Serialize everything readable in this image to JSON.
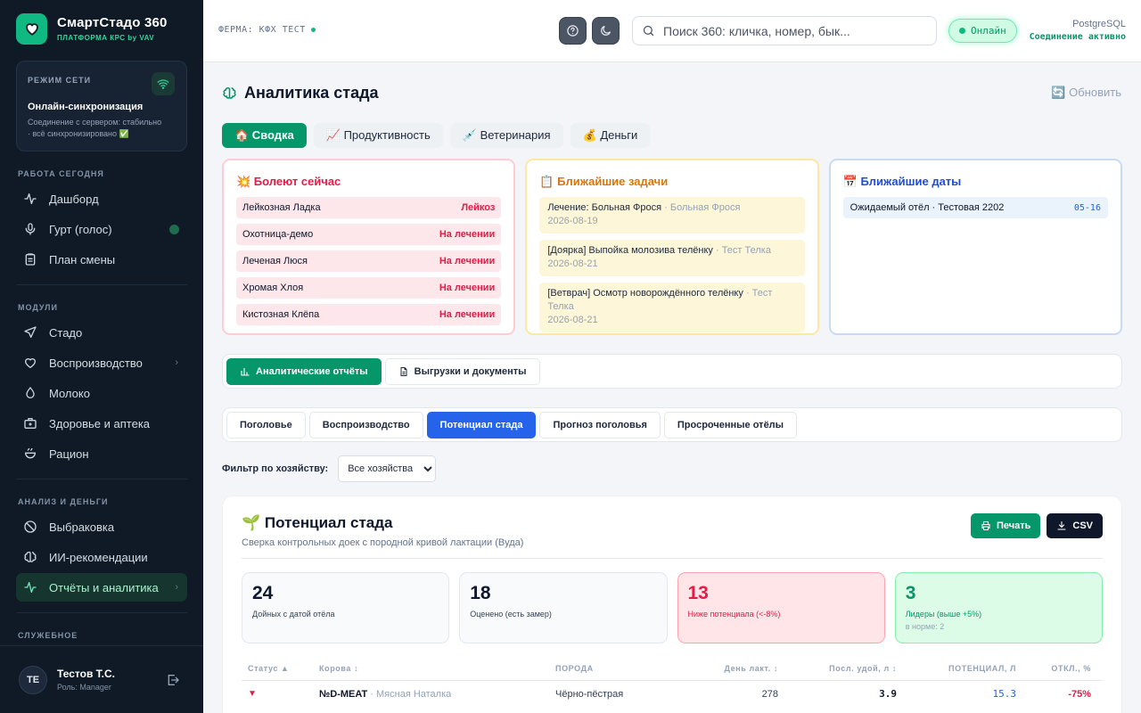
{
  "app": {
    "name": "СмартСтадо 360",
    "subtitle": "ПЛАТФОРМА КРС by VAV"
  },
  "network": {
    "label": "РЕЖИМ СЕТИ",
    "title": "Онлайн-синхронизация",
    "desc_line1": "Соединение с сервером: стабильно",
    "desc_line2": "· всё синхронизировано ✅"
  },
  "sidebar": {
    "sections": [
      "РАБОТА СЕГОДНЯ",
      "МОДУЛИ",
      "АНАЛИЗ И ДЕНЬГИ",
      "СЛУЖЕБНОЕ"
    ],
    "today": [
      "Дашборд",
      "Гурт (голос)",
      "План смены"
    ],
    "modules": [
      "Стадо",
      "Воспроизводство",
      "Молоко",
      "Здоровье и аптека",
      "Рацион"
    ],
    "analysis": [
      "Выбраковка",
      "ИИ-рекомендации",
      "Отчёты и аналитика"
    ]
  },
  "user": {
    "initials": "ТЕ",
    "name": "Тестов Т.С.",
    "role": "Роль: Manager"
  },
  "topbar": {
    "farm": "ФЕРМА: КФХ ТЕСТ",
    "search_placeholder": "Поиск 360: кличка, номер, бык...",
    "status": "Онлайн",
    "db_name": "PostgreSQL",
    "db_status": "Соединение активно"
  },
  "page": {
    "title": "Аналитика стада",
    "refresh": "🔄 Обновить"
  },
  "tabs": [
    "🏠 Сводка",
    "📈 Продуктивность",
    "💉 Ветеринария",
    "💰 Деньги"
  ],
  "sick": {
    "title": "💥 Болеют сейчас",
    "rows": [
      {
        "name": "Лейкозная Ладка",
        "status": "Лейкоз"
      },
      {
        "name": "Охотница-демо",
        "status": "На лечении"
      },
      {
        "name": "Леченая Люся",
        "status": "На лечении"
      },
      {
        "name": "Хромая Хлоя",
        "status": "На лечении"
      },
      {
        "name": "Кистозная Клёпа",
        "status": "На лечении"
      }
    ]
  },
  "tasks": {
    "title": "📋 Ближайшие задачи",
    "rows": [
      {
        "text": "Лечение: Больная Фрося",
        "who": "· Больная Фрося",
        "date": "2026-08-19"
      },
      {
        "text": "[Доярка] Выпойка молозива телёнку",
        "who": "· Тест Телка",
        "date": "2026-08-21"
      },
      {
        "text": "[Ветврач] Осмотр новорождённого телёнку",
        "who": "· Тест Телка",
        "date": "2026-08-21"
      }
    ]
  },
  "dates": {
    "title": "📅 Ближайшие даты",
    "rows": [
      {
        "text": "Ожидаемый отёл · Тестовая 2202",
        "date": "05-16"
      }
    ]
  },
  "report_tabs": [
    "Аналитические отчёты",
    "Выгрузки и документы"
  ],
  "sub_tabs": [
    "Поголовье",
    "Воспроизводство",
    "Потенциал стада",
    "Прогноз поголовья",
    "Просроченные отёлы"
  ],
  "filter": {
    "label": "Фильтр по хозяйству:",
    "value": "Все хозяйства"
  },
  "panel": {
    "title": "🌱 Потенциал стада",
    "subtitle": "Сверка контрольных доек с породной кривой лактации (Вуда)",
    "print": "Печать",
    "csv": "CSV"
  },
  "kpis": [
    {
      "value": "24",
      "label": "Дойных с датой отёла",
      "extra": ""
    },
    {
      "value": "18",
      "label": "Оценено (есть замер)",
      "extra": ""
    },
    {
      "value": "13",
      "label": "Ниже потенциала (<-8%)",
      "extra": ""
    },
    {
      "value": "3",
      "label": "Лидеры (выше +5%)",
      "extra": "в норме: 2"
    }
  ],
  "table": {
    "headers": [
      "Статус ▲",
      "Корова ↕",
      "ПОРОДА",
      "День лакт. ↕",
      "Посл. удой, л ↕",
      "ПОТЕНЦИАЛ, Л",
      "ОТКЛ., %"
    ],
    "rows": [
      {
        "status": "▼",
        "cow": "№D-MEAT",
        "cow_name": "· Мясная Наталка",
        "breed": "Чёрно-пёстрая",
        "day": "278",
        "yield": "3.9",
        "potential": "15.3",
        "dev": "-75%"
      }
    ]
  },
  "colors": {
    "accent": "#059669",
    "sidebar": "#0f1a26",
    "danger": "#e11d48",
    "primary": "#2563eb"
  }
}
